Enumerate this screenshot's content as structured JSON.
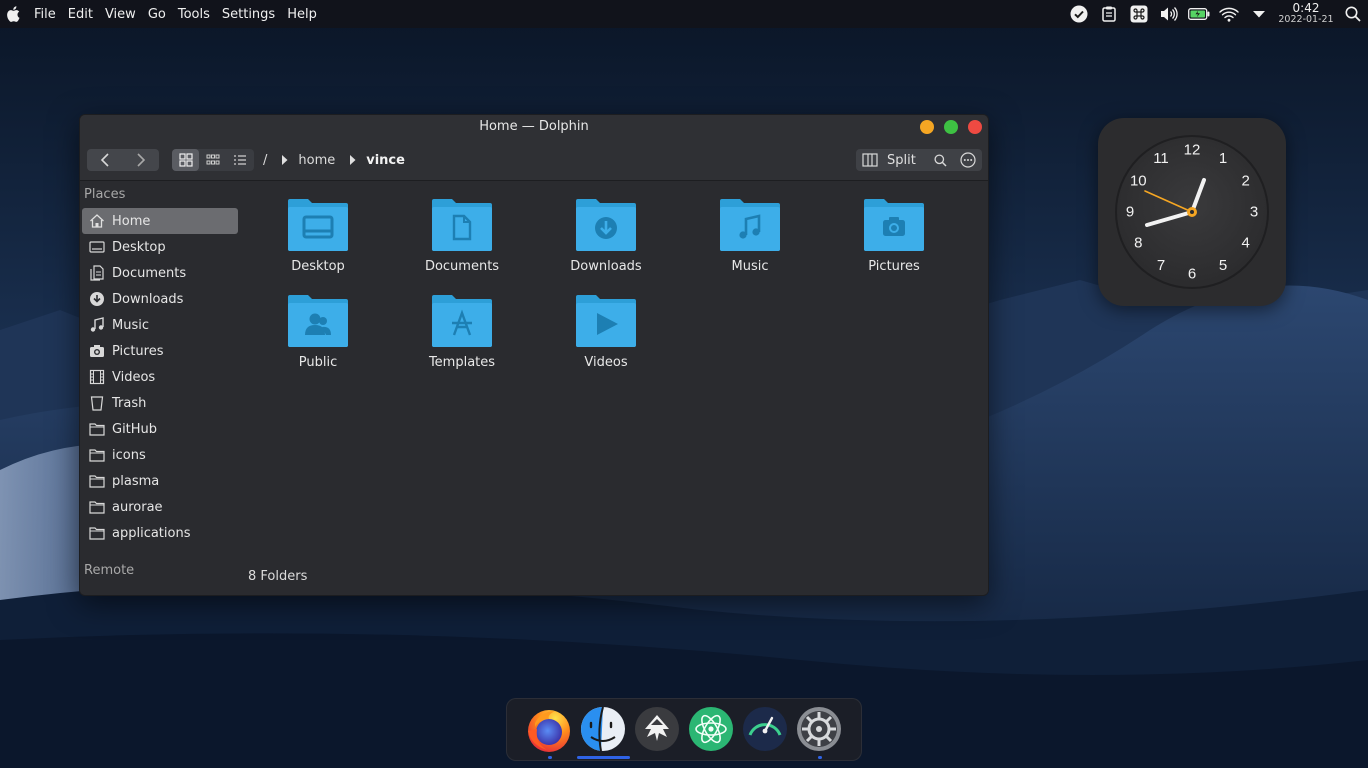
{
  "menubar": {
    "apple": "apple-logo",
    "menus": [
      "File",
      "Edit",
      "View",
      "Go",
      "Tools",
      "Settings",
      "Help"
    ],
    "clock_time": "0:42",
    "clock_date": "2022-01-21",
    "tray_icons": [
      "check-circle-icon",
      "clipboard-icon",
      "command-icon",
      "volume-icon",
      "battery-icon",
      "wifi-icon",
      "chevron-down-icon",
      "search-icon"
    ]
  },
  "window": {
    "title": "Home — Dolphin",
    "buttons": {
      "minimize_color": "#f5a623",
      "maximize_color": "#3ec143",
      "close_color": "#ee4a42"
    },
    "breadcrumb": {
      "root": "/",
      "segments": [
        "home",
        "vince"
      ]
    },
    "split_label": "Split",
    "sidebar": {
      "places_heading": "Places",
      "items": [
        {
          "label": "Home",
          "icon": "home-icon"
        },
        {
          "label": "Desktop",
          "icon": "desktop-icon"
        },
        {
          "label": "Documents",
          "icon": "documents-icon"
        },
        {
          "label": "Downloads",
          "icon": "downloads-icon"
        },
        {
          "label": "Music",
          "icon": "music-icon"
        },
        {
          "label": "Pictures",
          "icon": "camera-icon"
        },
        {
          "label": "Videos",
          "icon": "film-icon"
        },
        {
          "label": "Trash",
          "icon": "trash-icon"
        },
        {
          "label": "GitHub",
          "icon": "folder-icon"
        },
        {
          "label": "icons",
          "icon": "folder-icon"
        },
        {
          "label": "plasma",
          "icon": "folder-icon"
        },
        {
          "label": "aurorae",
          "icon": "folder-icon"
        },
        {
          "label": "applications",
          "icon": "folder-icon"
        }
      ],
      "remote_heading": "Remote"
    },
    "folders": [
      {
        "label": "Desktop",
        "icon": "desktop-folder-icon"
      },
      {
        "label": "Documents",
        "icon": "documents-folder-icon"
      },
      {
        "label": "Downloads",
        "icon": "downloads-folder-icon"
      },
      {
        "label": "Music",
        "icon": "music-folder-icon"
      },
      {
        "label": "Pictures",
        "icon": "pictures-folder-icon"
      },
      {
        "label": "Public",
        "icon": "public-folder-icon"
      },
      {
        "label": "Templates",
        "icon": "templates-folder-icon"
      },
      {
        "label": "Videos",
        "icon": "videos-folder-icon"
      }
    ],
    "folder_color": "#3daee9",
    "status": "8 Folders"
  },
  "clock_widget": {
    "numbers": [
      "12",
      "1",
      "2",
      "3",
      "4",
      "5",
      "6",
      "7",
      "8",
      "9",
      "10",
      "11"
    ],
    "hand_color": "#f5a623"
  },
  "dock": {
    "apps": [
      "firefox-icon",
      "finder-icon",
      "inkscape-icon",
      "atom-icon",
      "system-monitor-icon",
      "system-settings-icon"
    ]
  }
}
